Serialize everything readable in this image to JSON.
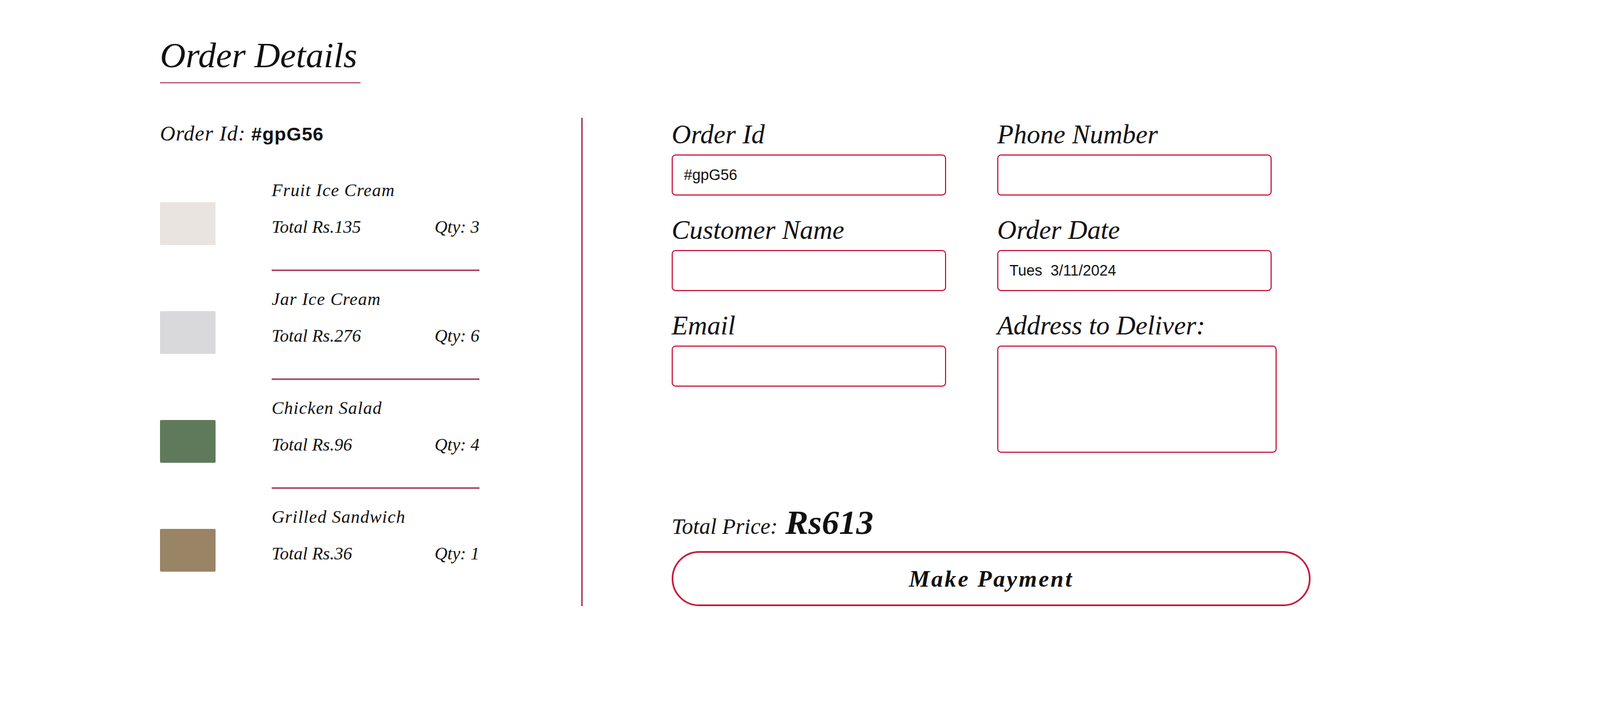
{
  "header": {
    "title": "Order Details"
  },
  "order": {
    "label": "Order Id:",
    "id": "#gpG56"
  },
  "items": [
    {
      "name": "Fruit Ice Cream",
      "total": "Total Rs.135",
      "qty": "Qty: 3"
    },
    {
      "name": "Jar Ice Cream",
      "total": "Total Rs.276",
      "qty": "Qty: 6"
    },
    {
      "name": "Chicken Salad",
      "total": "Total Rs.96",
      "qty": "Qty: 4"
    },
    {
      "name": "Grilled Sandwich",
      "total": "Total Rs.36",
      "qty": "Qty: 1"
    }
  ],
  "form": {
    "fields": [
      {
        "label": "Order Id",
        "value": "#gpG56",
        "kind": "input"
      },
      {
        "label": "Phone Number",
        "value": "",
        "kind": "input"
      },
      {
        "label": "Customer Name",
        "value": "",
        "kind": "input"
      },
      {
        "label": "Order Date",
        "value": "Tues  3/11/2024",
        "kind": "input"
      },
      {
        "label": "Email",
        "value": "",
        "kind": "input"
      },
      {
        "label": "Address to Deliver:",
        "value": "",
        "kind": "textarea"
      }
    ]
  },
  "total": {
    "label": "Total Price:",
    "value": "Rs613"
  },
  "buttons": [
    "Make Payment"
  ]
}
